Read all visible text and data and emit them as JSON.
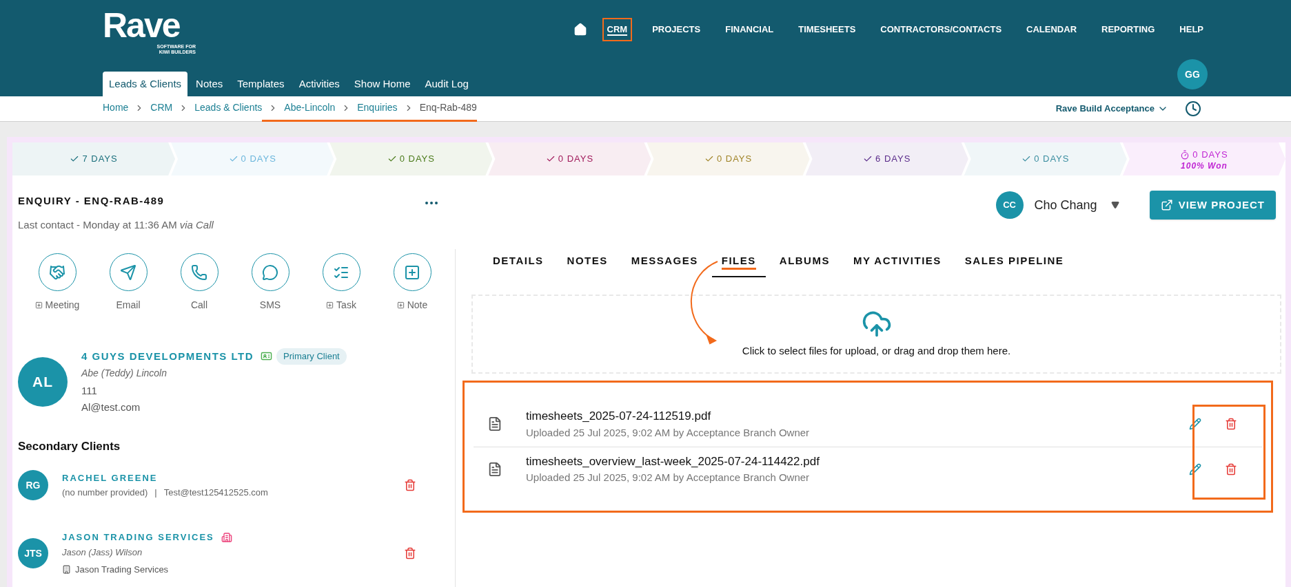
{
  "logo": {
    "name": "Rave",
    "tagline": [
      "SOFTWARE FOR",
      "KIWI BUILDERS"
    ]
  },
  "main_nav": [
    {
      "label": "CRM",
      "selected": true,
      "highlighted": true
    },
    {
      "label": "PROJECTS",
      "selected": false,
      "highlighted": false
    },
    {
      "label": "FINANCIAL",
      "selected": false,
      "highlighted": false
    },
    {
      "label": "TIMESHEETS",
      "selected": false,
      "highlighted": false
    },
    {
      "label": "CONTRACTORS/CONTACTS",
      "selected": false,
      "highlighted": false
    },
    {
      "label": "CALENDAR",
      "selected": false,
      "highlighted": false
    },
    {
      "label": "REPORTING",
      "selected": false,
      "highlighted": false
    },
    {
      "label": "HELP",
      "selected": false,
      "highlighted": false
    }
  ],
  "sub_nav": [
    {
      "label": "Leads & Clients",
      "selected": true
    },
    {
      "label": "Notes",
      "selected": false
    },
    {
      "label": "Templates",
      "selected": false
    },
    {
      "label": "Activities",
      "selected": false
    },
    {
      "label": "Show Home",
      "selected": false
    },
    {
      "label": "Audit Log",
      "selected": false
    }
  ],
  "user_avatar": "GG",
  "breadcrumb": [
    {
      "label": "Home",
      "underlined": false
    },
    {
      "label": "CRM",
      "underlined": false
    },
    {
      "label": "Leads & Clients",
      "underlined": false
    },
    {
      "label": "Abe-Lincoln",
      "underlined": true
    },
    {
      "label": "Enquiries",
      "underlined": true
    },
    {
      "label": "Enq-Rab-489",
      "underlined": true
    }
  ],
  "workspace": "Rave Build Acceptance",
  "stages": [
    {
      "kind": "check",
      "label": "7 DAYS",
      "color": "#1a6f7c"
    },
    {
      "kind": "check",
      "label": "0 DAYS",
      "color": "#6bb6dc"
    },
    {
      "kind": "check",
      "label": "0 DAYS",
      "color": "#4a7a1a"
    },
    {
      "kind": "check",
      "label": "0 DAYS",
      "color": "#a0195a"
    },
    {
      "kind": "check",
      "label": "0 DAYS",
      "color": "#a08428"
    },
    {
      "kind": "check",
      "label": "6 DAYS",
      "color": "#5a2b8a"
    },
    {
      "kind": "check",
      "label": "0 DAYS",
      "color": "#3b8ea0"
    },
    {
      "kind": "timer",
      "label": "0 DAYS",
      "subtitle": "100% Won",
      "color": "#c026d3"
    }
  ],
  "enquiry": {
    "title": "ENQUIRY - ENQ-RAB-489",
    "last_contact": "Last contact - Monday at 11:36 AM",
    "via": "via Call"
  },
  "assignee": {
    "initials": "CC",
    "name": "Cho Chang"
  },
  "view_project_button": "VIEW PROJECT",
  "quick_actions": [
    {
      "kind": "meeting",
      "label": "Meeting",
      "addable": true
    },
    {
      "kind": "email",
      "label": "Email",
      "addable": false
    },
    {
      "kind": "call",
      "label": "Call",
      "addable": false
    },
    {
      "kind": "sms",
      "label": "SMS",
      "addable": false
    },
    {
      "kind": "task",
      "label": "Task",
      "addable": true
    },
    {
      "kind": "note",
      "label": "Note",
      "addable": true
    }
  ],
  "primary_client": {
    "initials": "AL",
    "company": "4 GUYS DEVELOPMENTS LTD",
    "badge": "Primary Client",
    "contact": "Abe (Teddy) Lincoln",
    "phone": "111",
    "email": "Al@test.com"
  },
  "secondary_clients": {
    "title": "Secondary Clients",
    "items": [
      {
        "kind": "person",
        "initials": "RG",
        "name": "RACHEL GREENE",
        "phone": "(no number provided)",
        "separator": "|",
        "email": "Test@test125412525.com"
      },
      {
        "kind": "company",
        "initials": "JTS",
        "name": "JASON TRADING SERVICES",
        "contact": "Jason (Jass) Wilson",
        "organisation": "Jason Trading Services"
      }
    ]
  },
  "tabs": [
    {
      "label": "DETAILS",
      "selected": false,
      "annotated": false
    },
    {
      "label": "NOTES",
      "selected": false,
      "annotated": false
    },
    {
      "label": "MESSAGES",
      "selected": false,
      "annotated": false
    },
    {
      "label": "FILES",
      "selected": true,
      "annotated": true
    },
    {
      "label": "ALBUMS",
      "selected": false,
      "annotated": false
    },
    {
      "label": "MY ACTIVITIES",
      "selected": false,
      "annotated": false
    },
    {
      "label": "SALES PIPELINE",
      "selected": false,
      "annotated": false
    }
  ],
  "upload": {
    "text": "Click to select files for upload, or drag and drop them here."
  },
  "files": {
    "highlighted": true,
    "actions_highlighted": true,
    "items": [
      {
        "name": "timesheets_2025-07-24-112519.pdf",
        "meta": "Uploaded 25 Jul 2025, 9:02 AM by Acceptance Branch Owner"
      },
      {
        "name": "timesheets_overview_last-week_2025-07-24-114422.pdf",
        "meta": "Uploaded 25 Jul 2025, 9:02 AM by Acceptance Branch Owner"
      }
    ]
  }
}
